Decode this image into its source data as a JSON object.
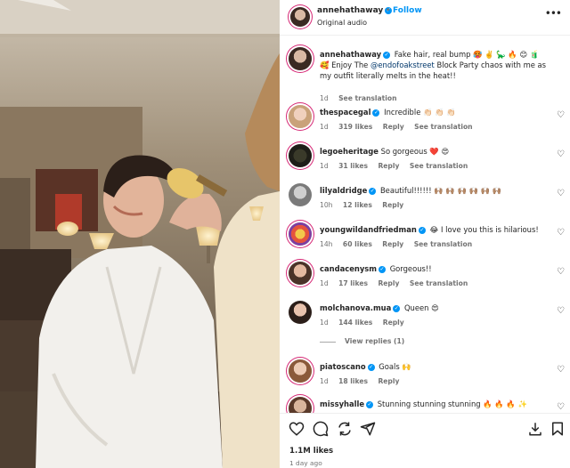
{
  "header": {
    "username": "annehathaway",
    "separator": "•",
    "follow_label": "Follow",
    "subtitle": "Original audio"
  },
  "caption": {
    "username": "annehathaway",
    "text_before": " Fake hair, real bump 🥵 ✌️ 🦕 🔥 😊 🧃 🥰 Enjoy The ",
    "mention": "@endofoakstreet",
    "text_after": " Block Party chaos with me as my outfit literally melts in the heat!!",
    "time": "1d",
    "see_translation": "See translation"
  },
  "comments": [
    {
      "username": "thespacegal",
      "verified": true,
      "text": "Incredible 👏🏻 👏🏻 👏🏻",
      "time": "1d",
      "likes": "319 likes",
      "reply": "Reply",
      "translation": "See translation"
    },
    {
      "username": "legoeheritage",
      "verified": false,
      "text": "So gorgeous ❤️ 😍",
      "time": "1d",
      "likes": "31 likes",
      "reply": "Reply",
      "translation": "See translation"
    },
    {
      "username": "lilyaldridge",
      "verified": true,
      "text": "Beautiful!!!!!! 🙌🏽 🙌🏽 🙌🏽 🙌🏽 🙌🏽 🙌🏽",
      "time": "10h",
      "likes": "12 likes",
      "reply": "Reply",
      "translation": ""
    },
    {
      "username": "youngwildandfriedman",
      "verified": true,
      "text": "😂 I love you this is hilarious!",
      "time": "14h",
      "likes": "60 likes",
      "reply": "Reply",
      "translation": "See translation"
    },
    {
      "username": "candacenysm",
      "verified": true,
      "text": "Gorgeous!!",
      "time": "1d",
      "likes": "17 likes",
      "reply": "Reply",
      "translation": "See translation"
    },
    {
      "username": "molchanova.mua",
      "verified": true,
      "text": "Queen 😍",
      "time": "1d",
      "likes": "144 likes",
      "reply": "Reply",
      "translation": ""
    },
    {
      "username": "piatoscano",
      "verified": true,
      "text": "Goals 🙌",
      "time": "1d",
      "likes": "18 likes",
      "reply": "Reply",
      "translation": ""
    },
    {
      "username": "missyhalle",
      "verified": true,
      "text": "Stunning stunning stunning 🔥 🔥 🔥 ✨",
      "time": "",
      "likes": "",
      "reply": "",
      "translation": ""
    }
  ],
  "view_replies": "View replies (1)",
  "footer": {
    "likes": "1.1M likes",
    "time_ago": "1 day ago"
  },
  "icons": {
    "like": "heart-icon",
    "comment": "comment-icon",
    "share": "share-icon",
    "save": "save-icon",
    "download": "download-icon",
    "more": "more-icon"
  },
  "colors": {
    "link": "#0095f6",
    "mention": "#00376b",
    "muted": "#737373",
    "story_ring": "#d62976"
  }
}
